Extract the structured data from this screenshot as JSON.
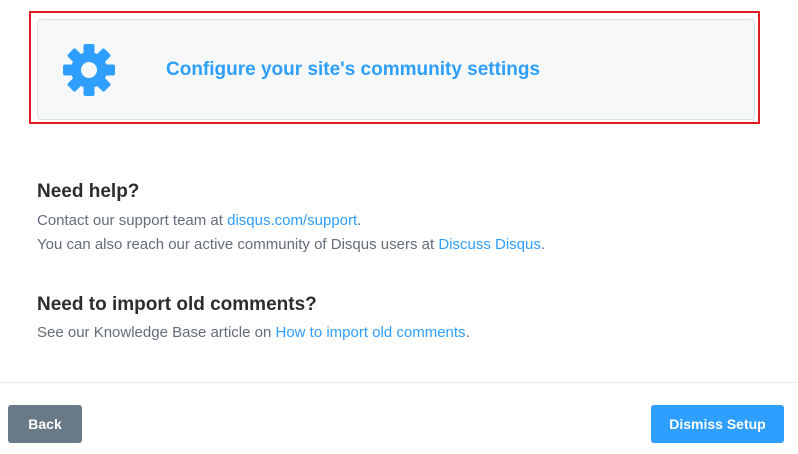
{
  "config_card": {
    "label": "Configure your site's community settings",
    "icon": "gear-icon"
  },
  "help": {
    "heading": "Need help?",
    "line1_prefix": "Contact our support team at ",
    "line1_link": "disqus.com/support",
    "line1_suffix": ".",
    "line2_prefix": "You can also reach our active community of Disqus users at ",
    "line2_link": "Discuss Disqus",
    "line2_suffix": "."
  },
  "import": {
    "heading": "Need to import old comments?",
    "line_prefix": "See our Knowledge Base article on ",
    "line_link": "How to import old comments",
    "line_suffix": "."
  },
  "footer": {
    "back_label": "Back",
    "dismiss_label": "Dismiss Setup"
  },
  "colors": {
    "accent": "#2e9fff",
    "highlight": "#e31b23",
    "back_button": "#687a86"
  }
}
